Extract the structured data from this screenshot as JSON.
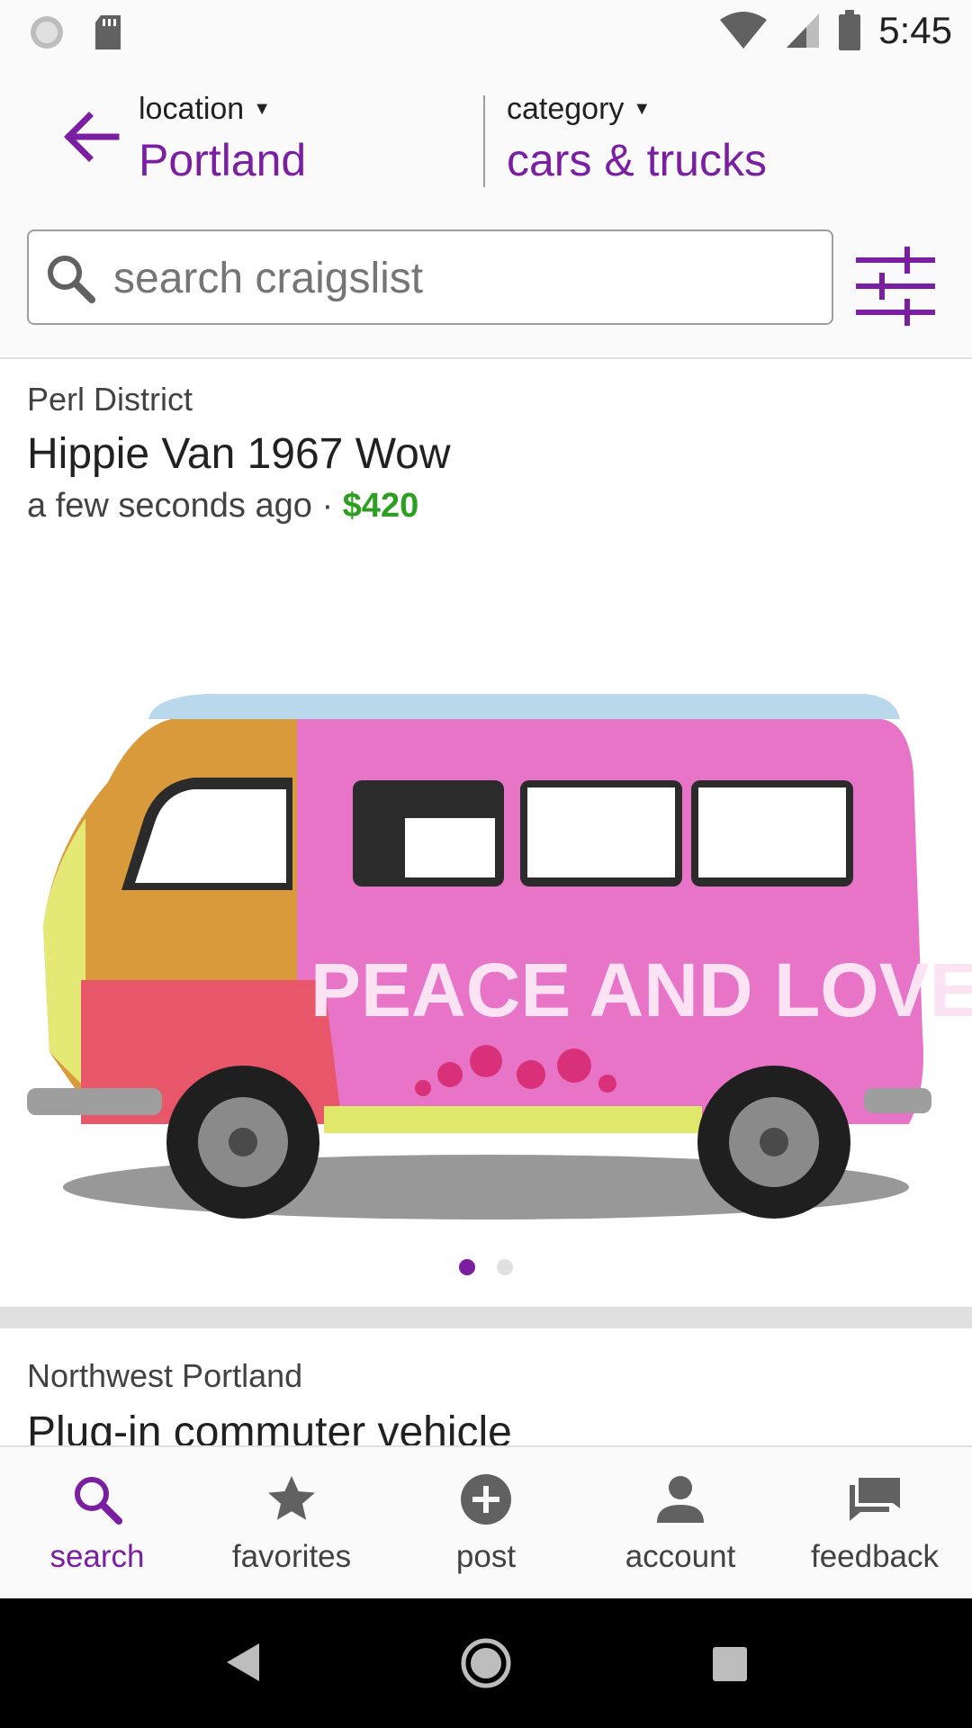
{
  "status_bar": {
    "time": "5:45"
  },
  "header": {
    "location_label": "location",
    "location_value": "Portland",
    "category_label": "category",
    "category_value": "cars & trucks"
  },
  "search": {
    "placeholder": "search craigslist"
  },
  "listings": [
    {
      "area": "Perl District",
      "title": "Hippie Van 1967 Wow",
      "posted": "a few seconds ago",
      "separator": "·",
      "price": "$420",
      "image_text": "PEACE AND LOVE",
      "image_count": 2,
      "image_index": 1
    },
    {
      "area": "Northwest Portland",
      "title": "Plug-in commuter vehicle"
    }
  ],
  "bottom_nav": [
    {
      "label": "search",
      "icon": "search-icon",
      "active": true
    },
    {
      "label": "favorites",
      "icon": "star-icon",
      "active": false
    },
    {
      "label": "post",
      "icon": "add-circle-icon",
      "active": false
    },
    {
      "label": "account",
      "icon": "person-icon",
      "active": false
    },
    {
      "label": "feedback",
      "icon": "chat-bubbles-icon",
      "active": false
    }
  ],
  "colors": {
    "accent": "#7b1fa2",
    "price": "#2e9e22"
  }
}
